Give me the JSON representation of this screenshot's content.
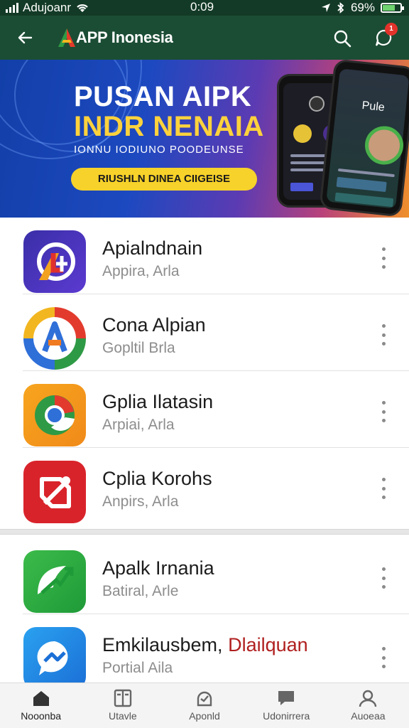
{
  "status_bar": {
    "carrier": "Adujoanr",
    "time": "0:09",
    "battery_percent": "69%",
    "battery_level": 0.69
  },
  "app_bar": {
    "title": "APP Inonesia",
    "notification_count": "1"
  },
  "banner": {
    "title_line1": "PUSAN AIPK",
    "title_line2": "INDR NENAIA",
    "subtitle": "IONNU IODIUNO  POODEUNSE",
    "cta_label": "RIUSHLN DINEA CIIGEISE",
    "phone_label": "Pule",
    "colors": {
      "title_accent": "#ffd23c",
      "cta": "#f7d22a"
    }
  },
  "apps": [
    {
      "name": "Apialndnain",
      "subtitle": "Appira, Arla",
      "icon": "purple-arrow-app-icon"
    },
    {
      "name": "Cona Alpian",
      "subtitle": "Gopltil Brla",
      "icon": "blue-a-app-icon"
    },
    {
      "name": "Gplia Ilatasin",
      "subtitle": "Arpiai, Arla",
      "icon": "orange-chrome-app-icon"
    },
    {
      "name": "Cplia Korohs",
      "subtitle": "Anpirs, Arla",
      "icon": "red-tag-app-icon"
    },
    {
      "name": "Apalk Irnania",
      "subtitle": "Batiral, Arle",
      "icon": "green-chart-app-icon"
    },
    {
      "name_main": "Emkilausbem,",
      "name_highlight": "Dlailquan",
      "subtitle": "Portial Aila",
      "icon": "blue-messenger-app-icon"
    }
  ],
  "bottom_nav": [
    {
      "label": "Nooonba",
      "icon": "home-icon",
      "active": true
    },
    {
      "label": "Utavle",
      "icon": "book-icon",
      "active": false
    },
    {
      "label": "Aponld",
      "icon": "apps-icon",
      "active": false
    },
    {
      "label": "Udonirrera",
      "icon": "message-icon",
      "active": false
    },
    {
      "label": "Auoeaa",
      "icon": "profile-icon",
      "active": false
    }
  ]
}
